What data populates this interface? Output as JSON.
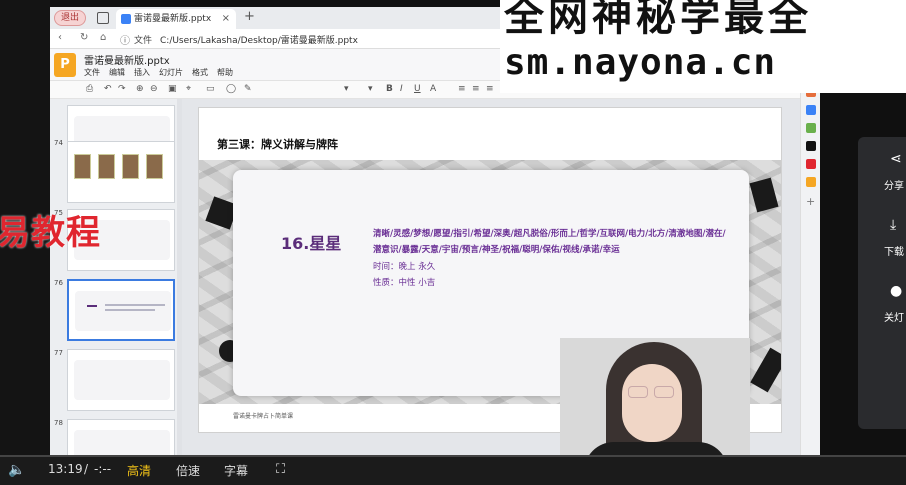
{
  "overlay": {
    "left_text": "易教程",
    "top_line1": "全网神秘学最全",
    "top_line2": "sm.nayona.cn"
  },
  "browser": {
    "pill_label": "退出",
    "tab_title": "雷诺曼最新版.pptx",
    "tab_close": "×",
    "new_tab": "+",
    "address_label": "文件",
    "address_url": "C:/Users/Lakasha/Desktop/雷诺曼最新版.pptx"
  },
  "document": {
    "logo_letter": "P",
    "title": "雷诺曼最新版.pptx",
    "menu": [
      "文件",
      "编辑",
      "插入",
      "幻灯片",
      "格式",
      "帮助"
    ]
  },
  "thumbnails": {
    "numbers": [
      "74",
      "75",
      "76",
      "77",
      "78"
    ],
    "selected_index": 2
  },
  "slide": {
    "heading": "第三课：牌义讲解与牌阵",
    "card_title": "16.星星",
    "keywords": "清晰/灵感/梦想/愿望/指引/希望/深奥/超凡脱俗/形而上/哲学/互联网/电力/北方/清澈地图/潜在/潜意识/暴露/天意/宇宙/预言/神圣/祝福/聪明/保佑/视线/承诺/幸运",
    "time": "时间：晚上 永久",
    "nature": "性质：中性 小吉",
    "footer": "雷诺曼卡牌占卜简单课",
    "page": "76"
  },
  "side_panel": {
    "share_label": "分享",
    "download_label": "下载",
    "lights_label": "关灯"
  },
  "player": {
    "time": "13:19",
    "separator": "/",
    "duration": "-:--",
    "quality": "高清",
    "speed": "倍速",
    "subtitles": "字幕",
    "progress": 0.0
  }
}
